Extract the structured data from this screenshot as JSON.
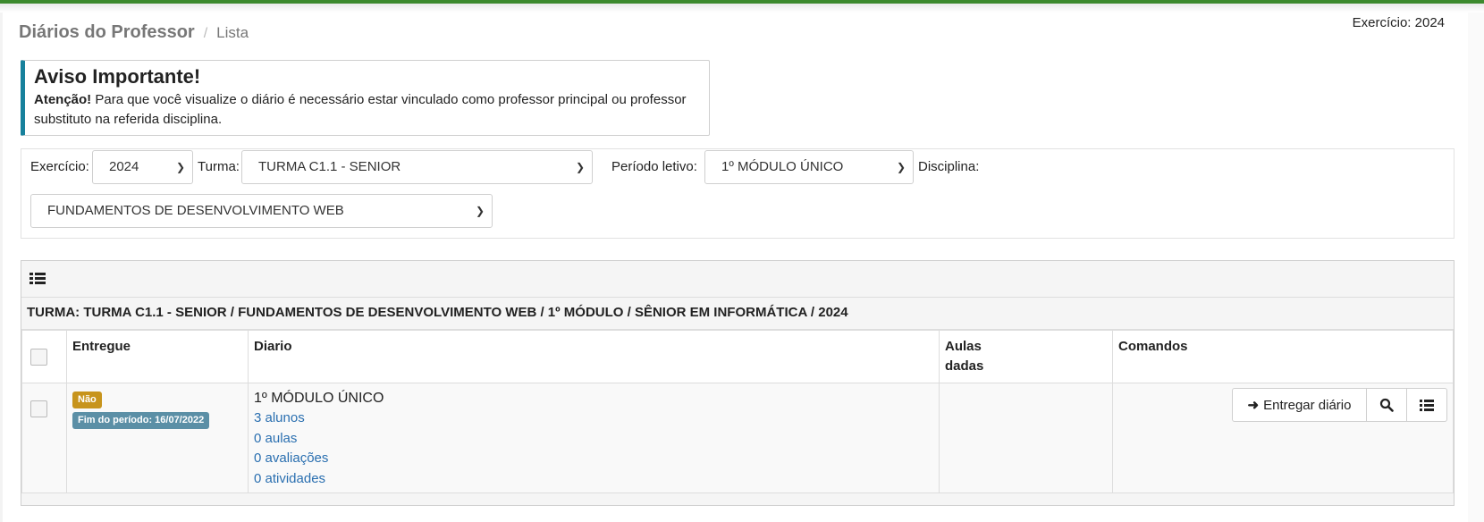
{
  "header": {
    "exercicio_label": "Exercício: 2024",
    "breadcrumb_title": "Diários do Professor",
    "breadcrumb_sep": "/",
    "breadcrumb_sub": "Lista"
  },
  "alert": {
    "title": "Aviso Importante!",
    "strong": "Atenção!",
    "text": " Para que você visualize o diário é necessário estar vinculado como professor principal ou professor substituto na referida disciplina."
  },
  "filters": {
    "exercicio_label": "Exercício:",
    "exercicio_value": "2024",
    "turma_label": "Turma:",
    "turma_value": "TURMA C1.1 - SENIOR",
    "periodo_label": "Período letivo:",
    "periodo_value": "1º MÓDULO ÚNICO",
    "disciplina_label": "Disciplina:",
    "disciplina_value": "FUNDAMENTOS DE DESENVOLVIMENTO WEB"
  },
  "panel": {
    "turma_heading": "TURMA: TURMA C1.1 - SENIOR / FUNDAMENTOS DE DESENVOLVIMENTO WEB / 1º MÓDULO / SÊNIOR EM INFORMÁTICA / 2024",
    "columns": {
      "entregue": "Entregue",
      "diario": "Diario",
      "aulas_line1": "Aulas",
      "aulas_line2": "dadas",
      "comandos": "Comandos"
    },
    "row": {
      "badge_status": "Não",
      "badge_period": "Fim do período: 16/07/2022",
      "diario_title": "1º MÓDULO ÚNICO",
      "alunos": "3 alunos",
      "aulas": "0 aulas",
      "avaliacoes": "0 avaliações",
      "atividades": "0 atividades",
      "aulas_dadas": "",
      "btn_entregar": "Entregar diário"
    }
  },
  "colors": {
    "accent_bar": "#3c8a2e",
    "alert_border": "#17819c",
    "badge_no": "#c7941c",
    "badge_period": "#5b8fa6",
    "link": "#2a6fb0"
  },
  "icons": {
    "list": "list-icon",
    "arrow": "arrow-right-icon",
    "search": "search-icon",
    "list_button": "list-icon",
    "chevron": "chevron-down-icon"
  }
}
